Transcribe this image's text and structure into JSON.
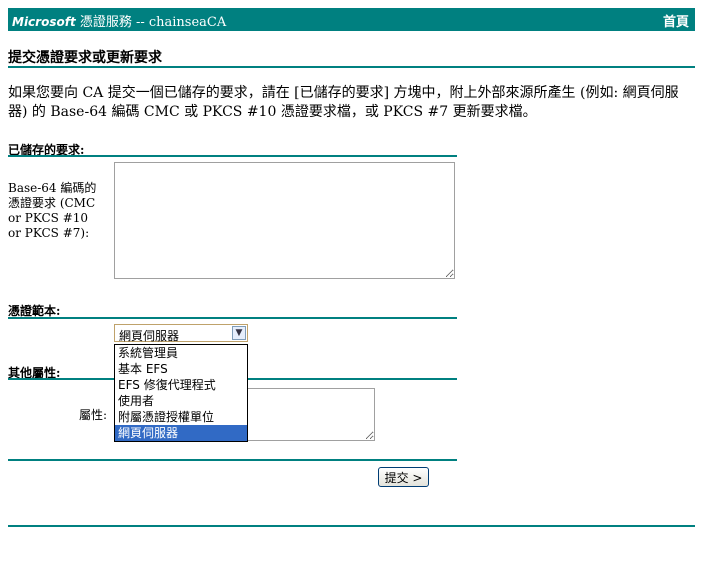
{
  "header": {
    "brand_ms": "Microsoft",
    "brand_rest": " 憑證服務  --  chainseaCA",
    "home_link": "首頁"
  },
  "page_title": "提交憑證要求或更新要求",
  "intro": "如果您要向 CA 提交一個已儲存的要求，請在 [已儲存的要求] 方塊中，附上外部來源所產生 (例如: 網頁伺服器) 的 Base-64 編碼 CMC 或 PKCS #10 憑證要求檔，或 PKCS #7 更新要求檔。",
  "saved_request": {
    "section_label": "已儲存的要求:",
    "field_label": "Base-64 編碼的憑證要求 (CMC or PKCS #10 or PKCS #7):",
    "value": ""
  },
  "template": {
    "section_label": "憑證範本:",
    "selected": "網頁伺服器",
    "options": [
      "系統管理員",
      "基本 EFS",
      "EFS 修復代理程式",
      "使用者",
      "附屬憑證授權單位",
      "網頁伺服器"
    ]
  },
  "attributes": {
    "section_label": "其他屬性:",
    "field_label": "屬性:",
    "value": ""
  },
  "submit_label": "提交 >"
}
